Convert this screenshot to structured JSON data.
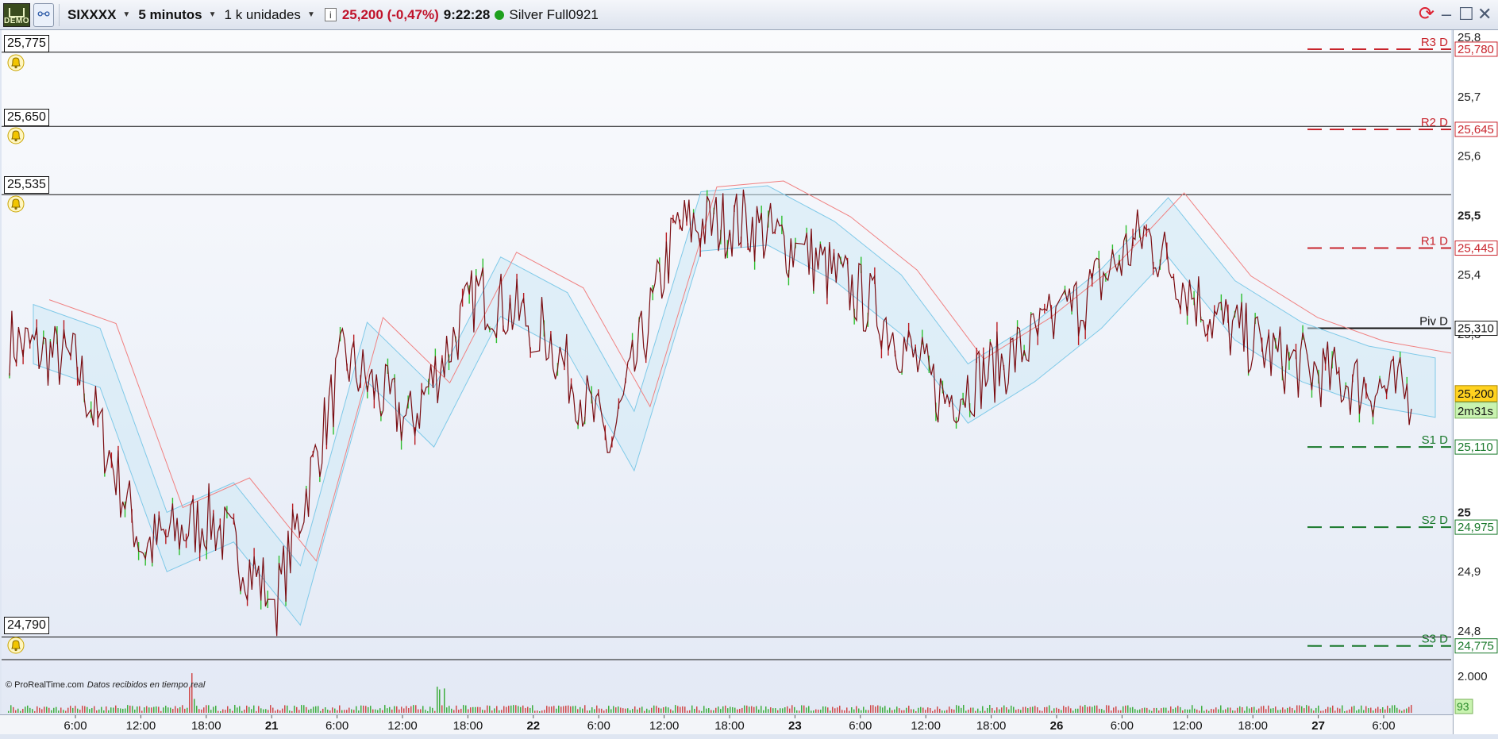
{
  "toolbar": {
    "logo_label": "DEMO",
    "instrument": "SIXXXX",
    "interval": "5 minutos",
    "units": "1 k unidades",
    "info_icon": "info-icon",
    "price": "25,200 (-0,47%)",
    "time": "9:22:28",
    "connection": "Silver Full0921",
    "status_color": "#1ea01e",
    "price_color": "#c0122a"
  },
  "alert_levels": [
    "25,775",
    "25,650",
    "25,535",
    "24,790"
  ],
  "credit": {
    "source": "© ProRealTime.com",
    "note": "Datos recibidos en tiempo real"
  },
  "pivots": [
    {
      "label": "R3 D",
      "value": "25,780",
      "color": "#c8242c"
    },
    {
      "label": "R2 D",
      "value": "25,645",
      "color": "#c8242c"
    },
    {
      "label": "R1 D",
      "value": "25,445",
      "color": "#c8242c"
    },
    {
      "label": "Piv D",
      "value": "25,310",
      "color": "#111111"
    },
    {
      "label": "S1 D",
      "value": "25,110",
      "color": "#18782a"
    },
    {
      "label": "S2 D",
      "value": "24,975",
      "color": "#18782a"
    },
    {
      "label": "S3 D",
      "value": "24,775",
      "color": "#18782a"
    }
  ],
  "y_axis": {
    "ticks": [
      "25,8",
      "25,7",
      "25,6",
      "25,5",
      "25,4",
      "25,3",
      "25",
      "24,9",
      "24,8"
    ],
    "current_price": "25,200",
    "countdown": "2m31s",
    "volume_tick": "2.000",
    "volume_value": "93"
  },
  "x_axis": {
    "labels": [
      "6:00",
      "12:00",
      "18:00",
      "21",
      "6:00",
      "12:00",
      "18:00",
      "22",
      "6:00",
      "12:00",
      "18:00",
      "23",
      "6:00",
      "12:00",
      "18:00",
      "26",
      "6:00",
      "12:00",
      "18:00",
      "27",
      "6:00"
    ]
  },
  "chart_data": {
    "type": "line",
    "title": "",
    "xlabel": "",
    "ylabel": "",
    "ylim": [
      24.78,
      25.82
    ],
    "grid": false,
    "x": [
      "20 6:00",
      "20 12:00",
      "20 18:00",
      "21 0:00",
      "21 6:00",
      "21 12:00",
      "21 18:00",
      "22 0:00",
      "22 6:00",
      "22 12:00",
      "22 18:00",
      "23 0:00",
      "23 6:00",
      "23 12:00",
      "23 18:00",
      "26 0:00",
      "26 6:00",
      "26 12:00",
      "26 18:00",
      "27 0:00",
      "27 6:00",
      "27 9:22"
    ],
    "series": [
      {
        "values": [
          25.29,
          25.25,
          24.94,
          24.99,
          24.85,
          25.26,
          25.15,
          25.37,
          25.31,
          25.11,
          25.48,
          25.49,
          25.43,
          25.34,
          25.19,
          25.26,
          25.35,
          25.47,
          25.33,
          25.26,
          25.22,
          25.2
        ]
      }
    ],
    "volume_max": 2000
  }
}
